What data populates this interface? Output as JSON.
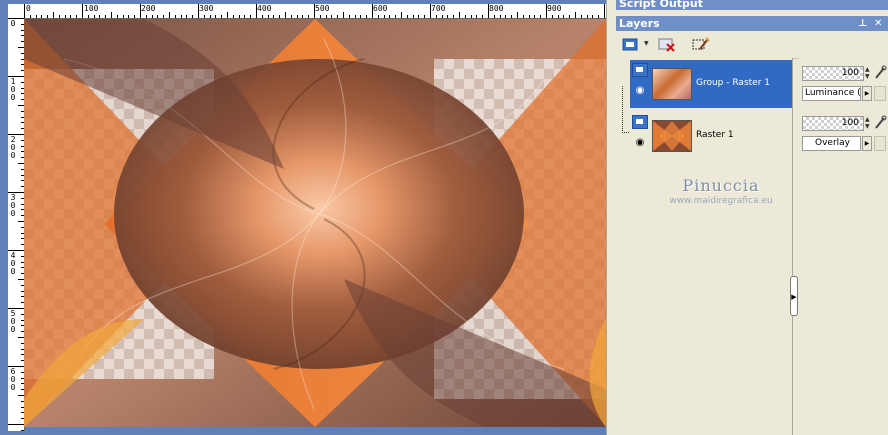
{
  "rulers": {
    "horizontal_labels": [
      "0",
      "100",
      "200",
      "300",
      "400",
      "500",
      "600",
      "700",
      "800",
      "900"
    ],
    "vertical_labels": [
      "0",
      "100",
      "200",
      "300",
      "400",
      "500",
      "600"
    ]
  },
  "panels": {
    "script_output": {
      "title": "Script Output"
    },
    "layers": {
      "title": "Layers"
    }
  },
  "toolbar": {
    "buttons": [
      {
        "icon": "new-raster-layer-icon"
      },
      {
        "icon": "delete-layer-icon"
      },
      {
        "icon": "edit-selection-icon"
      }
    ]
  },
  "layers": [
    {
      "name": "Group - Raster 1",
      "opacity": "100",
      "blend_mode": "Luminance (L)",
      "selected": true,
      "visible": true
    },
    {
      "name": "Raster 1",
      "opacity": "100",
      "blend_mode": "Overlay",
      "selected": false,
      "visible": true
    }
  ],
  "watermark": {
    "title": "Pinuccia",
    "url": "www.maidiregrafica.eu"
  },
  "colors": {
    "selection": "#316ac5",
    "titlebar": "#6f8fc6",
    "canvas_orange": "#e0702c",
    "canvas_brown": "#8a5a45"
  }
}
